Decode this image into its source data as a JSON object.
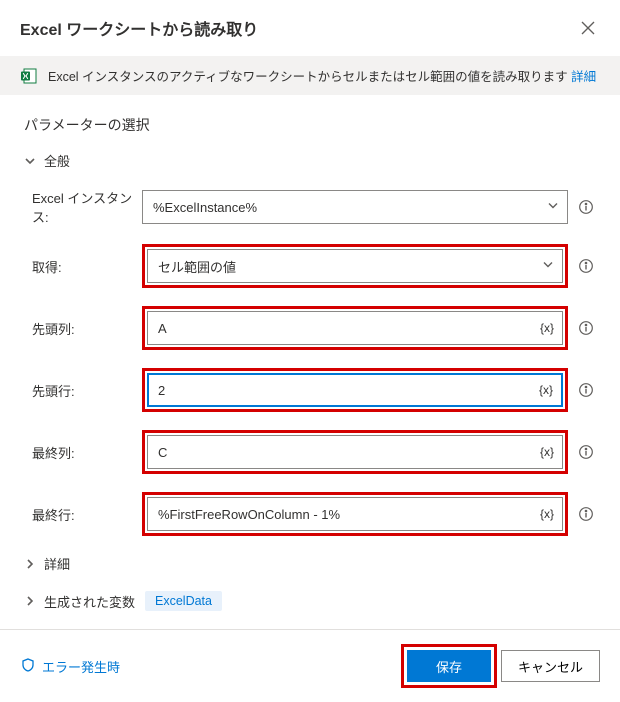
{
  "header": {
    "title": "Excel ワークシートから読み取り"
  },
  "banner": {
    "text": "Excel インスタンスのアクティブなワークシートからセルまたはセル範囲の値を読み取ります ",
    "link": "詳細"
  },
  "sections": {
    "parameters_title": "パラメーターの選択",
    "general_label": "全般",
    "advanced_label": "詳細",
    "generated_vars_label": "生成された変数",
    "generated_var_name": "ExcelData"
  },
  "fields": {
    "excel_instance": {
      "label": "Excel インスタンス:",
      "value": "%ExcelInstance%"
    },
    "retrieve": {
      "label": "取得:",
      "value": "セル範囲の値"
    },
    "start_column": {
      "label": "先頭列:",
      "value": "A"
    },
    "start_row": {
      "label": "先頭行:",
      "value": "2"
    },
    "end_column": {
      "label": "最終列:",
      "value": "C"
    },
    "end_row": {
      "label": "最終行:",
      "value": "%FirstFreeRowOnColumn - 1%"
    }
  },
  "tokens": {
    "var": "{x}"
  },
  "footer": {
    "on_error": "エラー発生時",
    "save": "保存",
    "cancel": "キャンセル"
  }
}
